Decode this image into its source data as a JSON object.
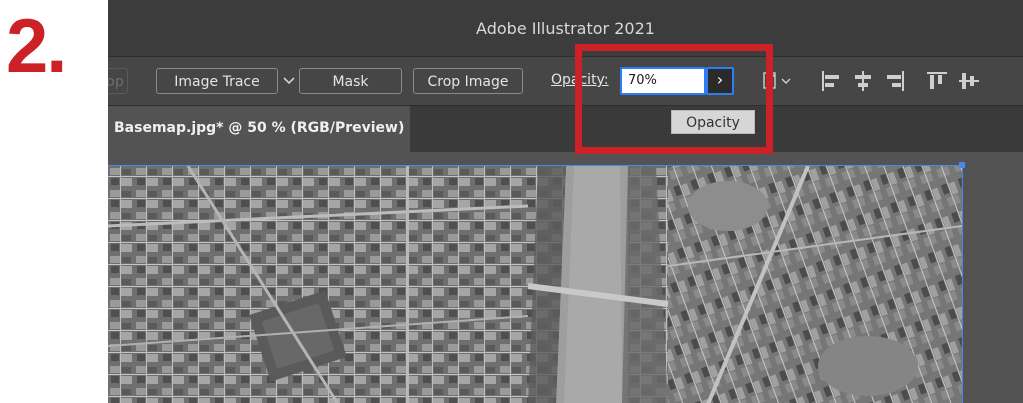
{
  "step": {
    "number": "2."
  },
  "window": {
    "title": "Adobe Illustrator 2021"
  },
  "control_bar": {
    "cropped_button_label": "op",
    "image_trace_label": "Image Trace",
    "mask_label": "Mask",
    "crop_image_label": "Crop Image",
    "opacity_label": "Opacity:",
    "opacity_value": "70%",
    "opacity_arrow": "›",
    "tooltip": "Opacity"
  },
  "document": {
    "tab_title": "Basemap.jpg* @ 50 % (RGB/Preview)"
  },
  "colors": {
    "highlight": "#cc2127",
    "selection": "#4a86f0",
    "input_focus": "#2d7ef5"
  }
}
